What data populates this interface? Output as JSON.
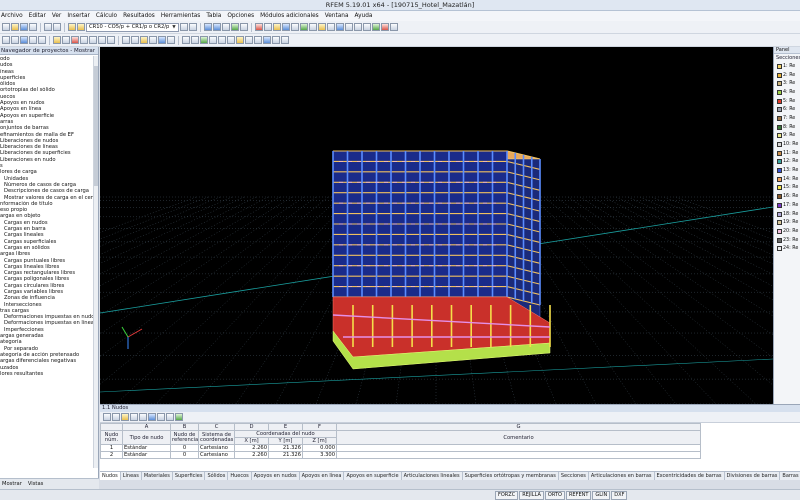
{
  "window": {
    "title": "RFEM 5.19.01 x64 - [190715_Hotel_Mazatlán]"
  },
  "menu": [
    "Archivo",
    "Editar",
    "Ver",
    "Insertar",
    "Cálculo",
    "Resultados",
    "Herramientas",
    "Tabla",
    "Opciones",
    "Módulos adicionales",
    "Ventana",
    "Ayuda"
  ],
  "toolbar": {
    "load_combo": "CR10 - CO5/p + CR1/p o CR2/p"
  },
  "left_panel": {
    "title": "Navegador de proyectos - Mostrar",
    "items": [
      "odo",
      "udos",
      "íneas",
      "uperficies",
      "ólidos",
      "ortotropías del sólido",
      "uecos",
      "Apoyos en nudos",
      "Apoyos en línea",
      "Apoyos en superficie",
      "arras",
      "onjuntos de barras",
      "efinamientos de malla de EF",
      "Liberaciones de nudos",
      "Liberaciones de líneas",
      "Liberaciones de superficies",
      "Liberaciones en nudo",
      "s",
      "lores de carga",
      "  Unidades",
      "  Números de casos de carga",
      "  Descripciones de casos de carga",
      "  Mostrar valores de carga en el cent",
      "nformación de título",
      "eso propio",
      "argas en objeto",
      "  Cargas en nudos",
      "  Cargas en barra",
      "  Cargas lineales",
      "  Cargas superficiales",
      "  Cargas en sólidos",
      "argas libres",
      "  Cargas puntuales libres",
      "  Cargas lineales libres",
      "  Cargas rectangulares libres",
      "  Cargas poligonales libres",
      "  Cargas circulares libres",
      "  Cargas variables libres",
      "  Zonas de influencia",
      "  Intersecciones",
      "tras cargas",
      "  Deformaciones impuestas en nudo",
      "  Deformaciones impuestas en línea",
      "  Imperfecciones",
      "argas generadas",
      "ategoría",
      "  Por separado",
      "ategoría de acción pretensado",
      "argas diferenciales negativas",
      "uzados",
      "lores resultantes"
    ],
    "footer_tabs": [
      "Mostrar",
      "Vistas"
    ]
  },
  "right_panel": {
    "title": "Panel",
    "header": "Secciones",
    "items": [
      {
        "label": "1: Re",
        "color": "#f2d36b"
      },
      {
        "label": "2: Re",
        "color": "#e8b33a"
      },
      {
        "label": "3: Re",
        "color": "#c9b27a"
      },
      {
        "label": "4: Re",
        "color": "#9fd248"
      },
      {
        "label": "5: Re",
        "color": "#e23a2a"
      },
      {
        "label": "6: Re",
        "color": "#9aa0b0"
      },
      {
        "label": "7: Re",
        "color": "#a0784a"
      },
      {
        "label": "8: Re",
        "color": "#3b7a3a"
      },
      {
        "label": "9: Re",
        "color": "#e9e58a"
      },
      {
        "label": "10: Re",
        "color": "#d7d7d7"
      },
      {
        "label": "11: Re",
        "color": "#c98d4c"
      },
      {
        "label": "12: Re",
        "color": "#3aa7a2"
      },
      {
        "label": "13: Re",
        "color": "#3a55d8"
      },
      {
        "label": "14: Re",
        "color": "#f0a05a"
      },
      {
        "label": "15: Re",
        "color": "#f6e64a"
      },
      {
        "label": "16: Re",
        "color": "#8a5a2a"
      },
      {
        "label": "17: Re",
        "color": "#7a38c8"
      },
      {
        "label": "18: Re",
        "color": "#b0a8d8"
      },
      {
        "label": "19: Re",
        "color": "#d8c89a"
      },
      {
        "label": "20: Re",
        "color": "#f3c1de"
      },
      {
        "label": "23: Re",
        "color": "#6a6a6a"
      },
      {
        "label": "24: Re",
        "color": "#ededed"
      }
    ]
  },
  "table": {
    "title": "1.1 Nudos",
    "col_letters": [
      "A",
      "B",
      "C",
      "D",
      "E",
      "F",
      "G"
    ],
    "headers": {
      "nudo": "Nudo núm.",
      "tipo": "Tipo de nudo",
      "ref": "Nudo de referencia",
      "sis": "Sistema de coordenadas",
      "coords": "Coordenadas del nudo",
      "x": "X [m]",
      "y": "Y [m]",
      "z": "Z [m]",
      "comentario": "Comentario"
    },
    "rows": [
      {
        "num": "1",
        "tipo": "Estándar",
        "ref": "0",
        "sis": "Cartesiano",
        "x": "2.260",
        "y": "21.326",
        "z": "0.000",
        "comentario": ""
      },
      {
        "num": "2",
        "tipo": "Estándar",
        "ref": "0",
        "sis": "Cartesiano",
        "x": "2.260",
        "y": "21.326",
        "z": "3.300",
        "comentario": ""
      }
    ]
  },
  "tabs": [
    "Nudos",
    "Líneas",
    "Materiales",
    "Superficies",
    "Sólidos",
    "Huecos",
    "Apoyos en nudos",
    "Apoyos en línea",
    "Apoyos en superficie",
    "Articulaciones lineales",
    "Superficies ortótropas y membranas",
    "Secciones",
    "Articulaciones en barras",
    "Excentricidades de barras",
    "Divisiones de barras",
    "Barras",
    "Apoyos elásticos en barra"
  ],
  "status": {
    "buttons": [
      "FORZC",
      "REJILLA",
      "ORTO",
      "REFENT",
      "GLIN",
      "DXF"
    ]
  }
}
